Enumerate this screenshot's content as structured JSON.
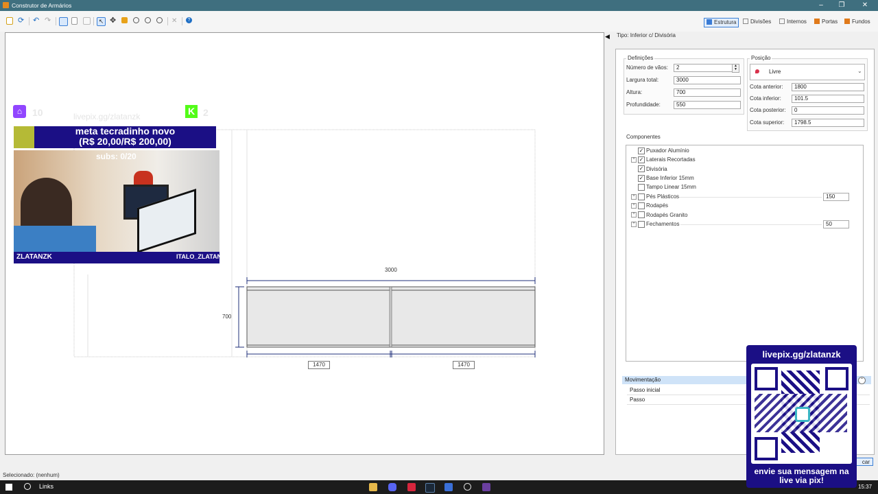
{
  "window": {
    "title": "Construtor de Armários",
    "controls": [
      "–",
      "❐",
      "✕"
    ]
  },
  "toolbar": {
    "tabs": [
      {
        "label": "Estrutura",
        "color": "#3a7bd5"
      },
      {
        "label": "Divisões",
        "color": "#888888"
      },
      {
        "label": "Internos",
        "color": "#888888"
      },
      {
        "label": "Portas",
        "color": "#e07a1a"
      },
      {
        "label": "Fundos",
        "color": "#e07a1a"
      }
    ]
  },
  "drawing": {
    "width_label": "3000",
    "height_label": "700",
    "span_left": "1470",
    "span_right": "1470"
  },
  "panel": {
    "type_label": "Tipo: Inferior c/ Divisória",
    "definitions": {
      "title": "Definições",
      "fields": [
        {
          "label": "Número de vãos:",
          "value": "2"
        },
        {
          "label": "Largura total:",
          "value": "3000"
        },
        {
          "label": "Altura:",
          "value": "700"
        },
        {
          "label": "Profundidade:",
          "value": "550"
        }
      ]
    },
    "position": {
      "title": "Posição",
      "selected": "Livre",
      "fields": [
        {
          "label": "Cota anterior:",
          "value": "1800"
        },
        {
          "label": "Cota inferior:",
          "value": "101.5"
        },
        {
          "label": "Cota posterior:",
          "value": "0"
        },
        {
          "label": "Cota superior:",
          "value": "1798.5"
        }
      ]
    },
    "components": {
      "title": "Componentes",
      "items": [
        {
          "label": "Puxador Alumínio",
          "checked": true,
          "expandable": false,
          "value": ""
        },
        {
          "label": "Laterais Recortadas",
          "checked": true,
          "expandable": true,
          "value": ""
        },
        {
          "label": "Divisória",
          "checked": true,
          "expandable": false,
          "value": ""
        },
        {
          "label": "Base Inferior 15mm",
          "checked": true,
          "expandable": false,
          "value": ""
        },
        {
          "label": "Tampo Linear 15mm",
          "checked": false,
          "expandable": false,
          "value": ""
        },
        {
          "label": "Pés Plásticos",
          "checked": false,
          "expandable": true,
          "value": "150"
        },
        {
          "label": "Rodapés",
          "checked": false,
          "expandable": true,
          "value": ""
        },
        {
          "label": "Rodapés Granito",
          "checked": false,
          "expandable": true,
          "value": ""
        },
        {
          "label": "Fechamentos",
          "checked": false,
          "expandable": true,
          "value": "50"
        }
      ]
    },
    "movement": {
      "title": "Movimentação",
      "rows": [
        "Passo inicial",
        "Passo"
      ]
    },
    "button_partial": "car"
  },
  "status": {
    "selected": "Selecionado: (nenhum)"
  },
  "taskbar": {
    "search_label": "Links",
    "clock": "15:37"
  },
  "overlay": {
    "meta_line1": "meta tecradinho novo",
    "meta_line2": "(R$ 20,00/R$ 200,00)",
    "subs": "subs: 0/20",
    "twitch_count": "10",
    "kick_count": "2",
    "faded_url": "livepix.gg/zlatanzk",
    "cam_left_name": "ZLATANZK",
    "cam_right_name": "ITALO_ZLATAN",
    "pix_url": "livepix.gg/zlatanzk",
    "pix_msg_line1": "envie sua mensagem na",
    "pix_msg_line2": "live via pix!"
  }
}
